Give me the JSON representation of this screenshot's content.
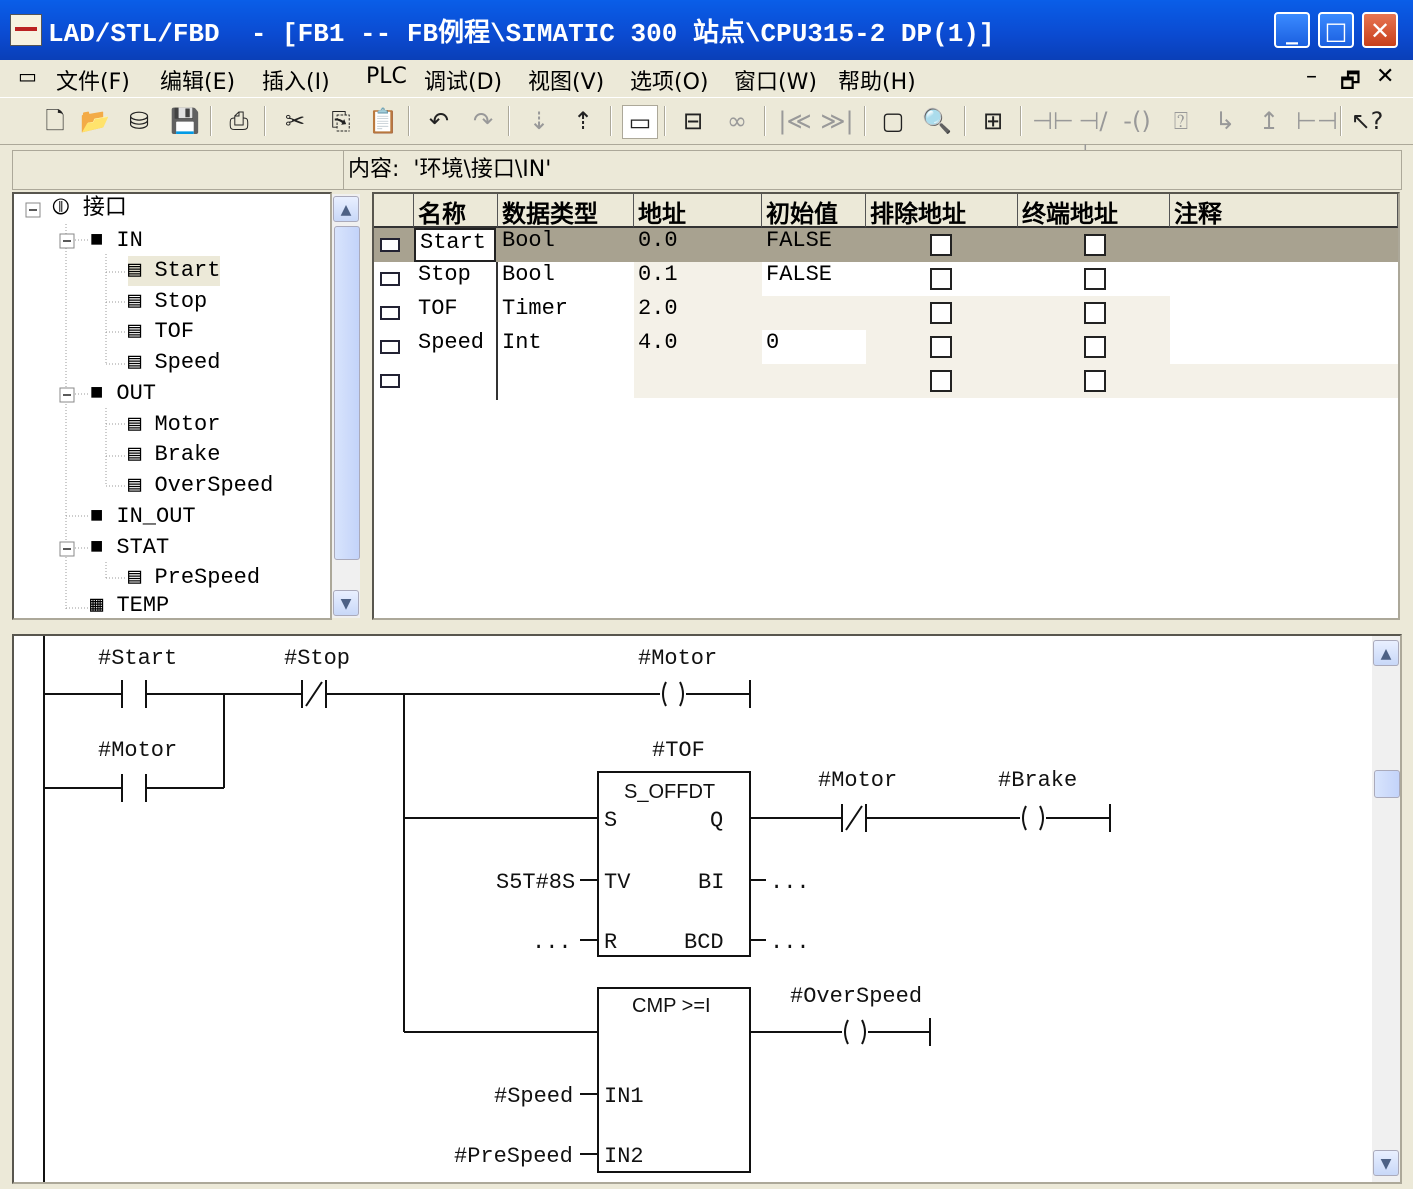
{
  "window": {
    "title": "LAD/STL/FBD  - [FB1 -- FB例程\\SIMATIC 300 站点\\CPU315-2 DP(1)]",
    "min": "_",
    "max": "□",
    "close": "✕"
  },
  "menu": {
    "items": [
      "文件(F)",
      "编辑(E)",
      "插入(I)",
      "PLC",
      "调试(D)",
      "视图(V)",
      "选项(O)",
      "窗口(W)",
      "帮助(H)"
    ],
    "restore": "🗗",
    "minimize": "–",
    "close": "✕"
  },
  "toolbar": {
    "icons": [
      "new-icon",
      "open-icon",
      "accessible-nodes-icon",
      "save-icon",
      "print-icon",
      "cut-icon",
      "copy-icon",
      "paste-icon",
      "undo-icon",
      "redo-icon",
      "download-icon",
      "upload-icon",
      "overview-icon",
      "monitor-icon",
      "glasses-icon",
      "first-network-icon",
      "last-network-icon",
      "layout-icon",
      "zoom-icon",
      "network-icon",
      "contact-no-icon",
      "contact-nc-icon",
      "coil-icon",
      "empty-box-icon",
      "branch-open-icon",
      "branch-close-icon",
      "connect-icon",
      "help-icon"
    ]
  },
  "content": {
    "label": "内容:  '环境\\接口\\IN'"
  },
  "tree": {
    "root": "接口",
    "nodes": [
      {
        "label": "IN"
      },
      {
        "label": "Start"
      },
      {
        "label": "Stop"
      },
      {
        "label": "TOF"
      },
      {
        "label": "Speed"
      },
      {
        "label": "OUT"
      },
      {
        "label": "Motor"
      },
      {
        "label": "Brake"
      },
      {
        "label": "OverSpeed"
      },
      {
        "label": "IN_OUT"
      },
      {
        "label": "STAT"
      },
      {
        "label": "PreSpeed"
      },
      {
        "label": "TEMP"
      }
    ]
  },
  "grid": {
    "headers": [
      "名称",
      "数据类型",
      "地址",
      "初始值",
      "排除地址",
      "终端地址",
      "注释"
    ],
    "rows": [
      {
        "name": "Start",
        "type": "Bool",
        "addr": "0.0",
        "init": "FALSE"
      },
      {
        "name": "Stop",
        "type": "Bool",
        "addr": "0.1",
        "init": "FALSE"
      },
      {
        "name": "TOF",
        "type": "Timer",
        "addr": "2.0",
        "init": ""
      },
      {
        "name": "Speed",
        "type": "Int",
        "addr": "4.0",
        "init": "0"
      },
      {
        "name": "",
        "type": "",
        "addr": "",
        "init": ""
      }
    ]
  },
  "ladder": {
    "start": "#Start",
    "stop": "#Stop",
    "motor": "#Motor",
    "tof": "#TOF",
    "s_offdt": "S_OFFDT",
    "pin_s": "S",
    "pin_q": "Q",
    "pin_tv": "TV",
    "pin_bi": "BI",
    "pin_r": "R",
    "pin_bcd": "BCD",
    "tv_value": "S5T#8S",
    "dots": "...",
    "motor2": "#Motor",
    "brake": "#Brake",
    "cmp": "CMP >=I",
    "overspeed": "#OverSpeed",
    "speed": "#Speed",
    "in1": "IN1",
    "prespeed": "#PreSpeed",
    "in2": "IN2"
  }
}
